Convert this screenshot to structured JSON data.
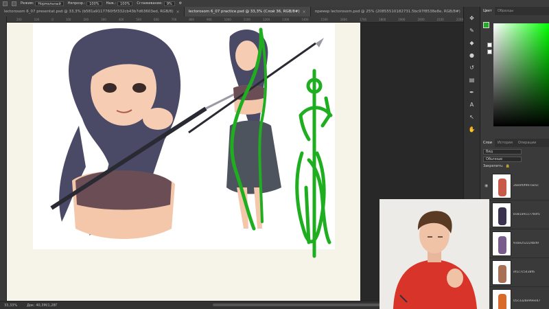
{
  "options_bar": {
    "mode_label": "Режим:",
    "mode_value": "Нормальный",
    "opacity_label": "Непрозр.:",
    "opacity_value": "100%",
    "flow_label": "Наж.:",
    "flow_value": "100%",
    "smoothing_label": "Сглаживание:",
    "smoothing_value": "9%"
  },
  "tabs": [
    {
      "label": "lectorosom 6_07 presentat.psd @ 33,3% (b581a9117760f5f332cb43b7d63603ed, RGB/8)",
      "active": false
    },
    {
      "label": "lectorosom 6_07 practice.psd @ 33,3% (Слой 36, RGB/8#)",
      "active": true
    },
    {
      "label": "пример lectorosom.psd @ 25% (20855510182731.5bc97f8538e8e, RGB/8#)",
      "active": false
    }
  ],
  "ruler_marks": [
    "200",
    "100",
    "0",
    "100",
    "200",
    "300",
    "400",
    "500",
    "600",
    "700",
    "800",
    "900",
    "1000",
    "1100",
    "1200",
    "1300",
    "1400",
    "1500",
    "1600",
    "1700",
    "1800",
    "1900",
    "2000",
    "2100",
    "2200",
    "2300",
    "2400"
  ],
  "status": {
    "zoom": "33,33%",
    "doc": "Док: 40,3M/1,28Г"
  },
  "color_panel": {
    "tabs": [
      "Цвет",
      "Образцы"
    ],
    "foreground": "#1fae1f"
  },
  "layers_panel": {
    "tabs": [
      "Слои",
      "История",
      "Операции"
    ],
    "kind_filter": "Вид",
    "blend_mode": "Обычные",
    "lock_label": "Закрепить:",
    "layers": [
      {
        "name": "28e0f0f997ae5c",
        "thumb_color": "#c85a4a"
      },
      {
        "name": "b581a9117760f5",
        "thumb_color": "#3b3250"
      },
      {
        "name": "93ae252224bd9",
        "thumb_color": "#7a5c8c"
      },
      {
        "name": "ef1c7c5438f6",
        "thumb_color": "#a87055"
      },
      {
        "name": "05c3328e99ee47",
        "thumb_color": "#d86a2a"
      }
    ]
  },
  "icons": {
    "tool_strip": [
      "move-icon",
      "brush-icon",
      "paint-bucket-icon",
      "dodge-icon",
      "history-brush-icon",
      "gradient-icon",
      "pen-icon",
      "text-icon",
      "path-select-icon",
      "hand-icon"
    ]
  }
}
